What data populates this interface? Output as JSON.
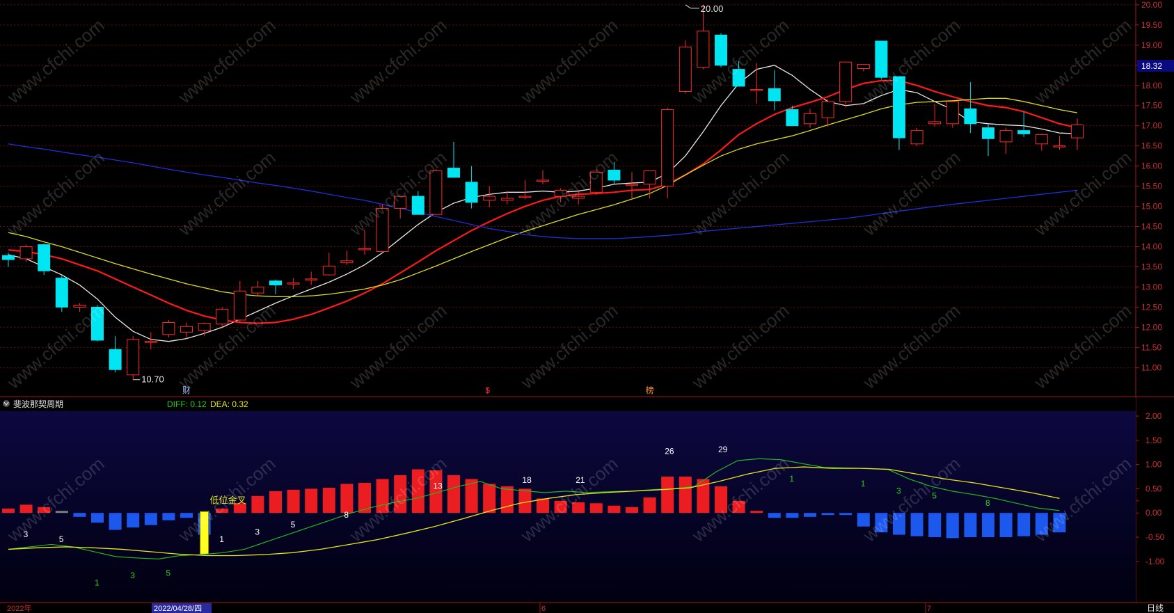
{
  "colors": {
    "up": "#ff2a2a",
    "down": "#00e5f2",
    "ma5": "#e8e8e8",
    "ma10": "#ff1a1a",
    "ma20": "#dcdc20",
    "ma60": "#2030d8",
    "diff": "#22b822",
    "dea": "#e6e620",
    "hist_up": "#ff2020",
    "hist_down": "#2060ff",
    "hist_neutral": "#888888",
    "grid": "#6a0a0a",
    "axis_text": "#cc3030",
    "sub_bg_top": "#0d0840",
    "sub_bg_bottom": "#000010"
  },
  "chart_data": [
    {
      "type": "candlestick",
      "y_axis_ticks": [
        "20.00",
        "19.50",
        "19.00",
        "18.50",
        "18.00",
        "17.50",
        "17.00",
        "16.50",
        "16.00",
        "15.50",
        "15.00",
        "14.50",
        "14.00",
        "13.50",
        "13.00",
        "12.50",
        "12.00",
        "11.50",
        "11.00"
      ],
      "ylim": [
        10.35,
        20.05
      ],
      "current_price_label": "18.32",
      "current_price_value": 18.32,
      "high_annotation": "20.00",
      "high_value": 20.0,
      "high_index": 38,
      "low_annotation": "10.70",
      "low_value": 10.7,
      "low_index": 7,
      "event_markers": [
        {
          "index": 10,
          "label": "财",
          "color": "#a0c0ff"
        },
        {
          "index": 27,
          "label": "$",
          "color": "#ff3030"
        },
        {
          "index": 36,
          "label": "榜",
          "color": "#ff9030"
        }
      ],
      "candles": [
        {
          "o": 13.78,
          "h": 13.85,
          "l": 13.5,
          "c": 13.68
        },
        {
          "o": 13.7,
          "h": 14.05,
          "l": 13.62,
          "c": 14.0
        },
        {
          "o": 14.05,
          "h": 14.08,
          "l": 13.3,
          "c": 13.4
        },
        {
          "o": 13.22,
          "h": 13.28,
          "l": 12.38,
          "c": 12.5
        },
        {
          "o": 12.5,
          "h": 12.6,
          "l": 12.38,
          "c": 12.55
        },
        {
          "o": 12.5,
          "h": 12.55,
          "l": 11.65,
          "c": 11.68
        },
        {
          "o": 11.45,
          "h": 11.78,
          "l": 10.88,
          "c": 10.95
        },
        {
          "o": 10.82,
          "h": 11.78,
          "l": 10.7,
          "c": 11.7
        },
        {
          "o": 11.65,
          "h": 11.88,
          "l": 11.45,
          "c": 11.65
        },
        {
          "o": 11.82,
          "h": 12.18,
          "l": 11.75,
          "c": 12.12
        },
        {
          "o": 11.88,
          "h": 12.12,
          "l": 11.72,
          "c": 12.02
        },
        {
          "o": 11.92,
          "h": 12.12,
          "l": 11.78,
          "c": 12.1
        },
        {
          "o": 12.08,
          "h": 12.5,
          "l": 12.0,
          "c": 12.45
        },
        {
          "o": 12.18,
          "h": 13.15,
          "l": 12.1,
          "c": 12.9
        },
        {
          "o": 12.85,
          "h": 13.15,
          "l": 12.78,
          "c": 13.0
        },
        {
          "o": 13.15,
          "h": 13.18,
          "l": 12.82,
          "c": 13.05
        },
        {
          "o": 13.08,
          "h": 13.22,
          "l": 12.95,
          "c": 13.1
        },
        {
          "o": 13.18,
          "h": 13.38,
          "l": 13.05,
          "c": 13.2
        },
        {
          "o": 13.3,
          "h": 13.85,
          "l": 13.28,
          "c": 13.52
        },
        {
          "o": 13.6,
          "h": 13.9,
          "l": 13.55,
          "c": 13.65
        },
        {
          "o": 13.95,
          "h": 14.42,
          "l": 13.8,
          "c": 13.95
        },
        {
          "o": 13.88,
          "h": 15.05,
          "l": 13.85,
          "c": 14.95
        },
        {
          "o": 14.95,
          "h": 15.2,
          "l": 14.7,
          "c": 15.25
        },
        {
          "o": 15.25,
          "h": 15.38,
          "l": 14.82,
          "c": 14.8
        },
        {
          "o": 14.8,
          "h": 15.92,
          "l": 14.8,
          "c": 15.88
        },
        {
          "o": 15.95,
          "h": 16.6,
          "l": 15.72,
          "c": 15.72
        },
        {
          "o": 15.6,
          "h": 16.0,
          "l": 14.95,
          "c": 15.1
        },
        {
          "o": 15.15,
          "h": 15.5,
          "l": 14.98,
          "c": 15.25
        },
        {
          "o": 15.15,
          "h": 15.38,
          "l": 15.05,
          "c": 15.2
        },
        {
          "o": 15.25,
          "h": 15.65,
          "l": 15.18,
          "c": 15.25
        },
        {
          "o": 15.65,
          "h": 15.9,
          "l": 15.55,
          "c": 15.65
        },
        {
          "o": 15.25,
          "h": 15.45,
          "l": 15.1,
          "c": 15.4
        },
        {
          "o": 15.2,
          "h": 15.4,
          "l": 15.05,
          "c": 15.25
        },
        {
          "o": 15.35,
          "h": 15.92,
          "l": 15.28,
          "c": 15.85
        },
        {
          "o": 15.9,
          "h": 16.1,
          "l": 15.55,
          "c": 15.65
        },
        {
          "o": 15.55,
          "h": 15.85,
          "l": 15.18,
          "c": 15.55
        },
        {
          "o": 15.55,
          "h": 15.88,
          "l": 15.2,
          "c": 15.88
        },
        {
          "o": 15.5,
          "h": 17.45,
          "l": 15.2,
          "c": 17.4
        },
        {
          "o": 17.85,
          "h": 19.12,
          "l": 17.8,
          "c": 18.95
        },
        {
          "o": 18.45,
          "h": 20.0,
          "l": 18.4,
          "c": 19.35
        },
        {
          "o": 19.25,
          "h": 19.3,
          "l": 18.45,
          "c": 18.5
        },
        {
          "o": 18.4,
          "h": 18.6,
          "l": 17.98,
          "c": 17.98
        },
        {
          "o": 17.88,
          "h": 18.55,
          "l": 17.55,
          "c": 17.9
        },
        {
          "o": 17.92,
          "h": 18.38,
          "l": 17.38,
          "c": 17.62
        },
        {
          "o": 17.4,
          "h": 17.5,
          "l": 17.1,
          "c": 17.0
        },
        {
          "o": 17.05,
          "h": 17.42,
          "l": 16.95,
          "c": 17.3
        },
        {
          "o": 17.2,
          "h": 17.65,
          "l": 16.98,
          "c": 17.6
        },
        {
          "o": 17.6,
          "h": 18.55,
          "l": 17.45,
          "c": 18.58
        },
        {
          "o": 18.42,
          "h": 18.5,
          "l": 18.35,
          "c": 18.52
        },
        {
          "o": 19.1,
          "h": 19.1,
          "l": 18.15,
          "c": 18.2
        },
        {
          "o": 18.22,
          "h": 18.22,
          "l": 16.4,
          "c": 16.7
        },
        {
          "o": 16.55,
          "h": 16.95,
          "l": 16.5,
          "c": 16.88
        },
        {
          "o": 17.05,
          "h": 17.55,
          "l": 16.98,
          "c": 17.1
        },
        {
          "o": 17.05,
          "h": 17.6,
          "l": 16.95,
          "c": 17.6
        },
        {
          "o": 17.42,
          "h": 18.08,
          "l": 16.82,
          "c": 17.05
        },
        {
          "o": 16.95,
          "h": 17.05,
          "l": 16.25,
          "c": 16.68
        },
        {
          "o": 16.6,
          "h": 16.95,
          "l": 16.3,
          "c": 16.88
        },
        {
          "o": 16.88,
          "h": 17.35,
          "l": 16.72,
          "c": 16.8
        },
        {
          "o": 16.55,
          "h": 16.8,
          "l": 16.38,
          "c": 16.78
        },
        {
          "o": 16.5,
          "h": 16.75,
          "l": 16.4,
          "c": 16.5
        },
        {
          "o": 16.7,
          "h": 17.18,
          "l": 16.4,
          "c": 17.02
        }
      ],
      "ma_series": [
        {
          "key": "ma5",
          "values": [
            13.8,
            13.7,
            13.5,
            13.3,
            13.05,
            12.7,
            12.25,
            11.9,
            11.7,
            11.65,
            11.72,
            11.85,
            12.0,
            12.2,
            12.4,
            12.6,
            12.78,
            12.95,
            13.12,
            13.32,
            13.55,
            13.85,
            14.2,
            14.55,
            14.85,
            15.08,
            15.22,
            15.3,
            15.35,
            15.35,
            15.38,
            15.35,
            15.38,
            15.45,
            15.55,
            15.58,
            15.6,
            15.82,
            16.25,
            16.85,
            17.5,
            18.05,
            18.4,
            18.5,
            18.25,
            17.9,
            17.6,
            17.5,
            17.55,
            17.75,
            17.9,
            17.82,
            17.6,
            17.4,
            17.1,
            17.05,
            17.02,
            17.0,
            16.92,
            16.82,
            16.8
          ]
        },
        {
          "key": "ma10",
          "values": [
            13.92,
            13.88,
            13.8,
            13.7,
            13.55,
            13.4,
            13.2,
            13.0,
            12.8,
            12.6,
            12.42,
            12.28,
            12.18,
            12.12,
            12.1,
            12.12,
            12.2,
            12.32,
            12.48,
            12.65,
            12.85,
            13.08,
            13.35,
            13.62,
            13.9,
            14.15,
            14.4,
            14.62,
            14.82,
            15.0,
            15.15,
            15.25,
            15.3,
            15.32,
            15.35,
            15.4,
            15.42,
            15.55,
            15.78,
            16.05,
            16.4,
            16.78,
            17.05,
            17.28,
            17.45,
            17.58,
            17.72,
            17.9,
            18.05,
            18.12,
            18.12,
            18.0,
            17.85,
            17.72,
            17.6,
            17.5,
            17.45,
            17.35,
            17.2,
            17.05,
            16.95
          ]
        },
        {
          "key": "ma20",
          "values": [
            14.35,
            14.25,
            14.12,
            14.0,
            13.86,
            13.72,
            13.58,
            13.45,
            13.32,
            13.2,
            13.08,
            12.98,
            12.88,
            12.82,
            12.78,
            12.76,
            12.76,
            12.78,
            12.82,
            12.88,
            12.95,
            13.05,
            13.18,
            13.35,
            13.52,
            13.7,
            13.88,
            14.05,
            14.22,
            14.38,
            14.52,
            14.66,
            14.8,
            14.92,
            15.04,
            15.18,
            15.32,
            15.52,
            15.78,
            16.02,
            16.25,
            16.42,
            16.55,
            16.65,
            16.75,
            16.88,
            17.02,
            17.15,
            17.28,
            17.42,
            17.52,
            17.58,
            17.6,
            17.62,
            17.65,
            17.68,
            17.68,
            17.6,
            17.5,
            17.4,
            17.32
          ]
        },
        {
          "key": "ma60",
          "values": [
            16.55,
            16.48,
            16.42,
            16.35,
            16.28,
            16.22,
            16.15,
            16.08,
            16.0,
            15.92,
            15.85,
            15.78,
            15.72,
            15.65,
            15.58,
            15.52,
            15.45,
            15.38,
            15.3,
            15.22,
            15.15,
            15.05,
            14.95,
            14.85,
            14.75,
            14.65,
            14.55,
            14.45,
            14.38,
            14.3,
            14.25,
            14.22,
            14.2,
            14.2,
            14.2,
            14.22,
            14.25,
            14.28,
            14.32,
            14.38,
            14.42,
            14.46,
            14.5,
            14.54,
            14.58,
            14.62,
            14.66,
            14.7,
            14.76,
            14.82,
            14.88,
            14.94,
            15.0,
            15.05,
            15.1,
            15.15,
            15.2,
            15.25,
            15.3,
            15.35,
            15.4
          ]
        }
      ]
    },
    {
      "type": "bar",
      "panel_title": "斐波那契周期",
      "diff_label": "DIFF: 0.12",
      "dea_label": "DEA: 0.32",
      "y_axis_ticks": [
        "2.00",
        "1.50",
        "1.00",
        "0.50",
        "0.00",
        "-0.50",
        "-1.00"
      ],
      "ylim": [
        -1.85,
        2.1
      ],
      "histogram": [
        0.09,
        0.17,
        0.12,
        0.0,
        -0.08,
        -0.2,
        -0.35,
        -0.3,
        -0.25,
        -0.15,
        -0.1,
        -0.45,
        0.09,
        0.2,
        0.35,
        0.45,
        0.48,
        0.5,
        0.52,
        0.6,
        0.62,
        0.7,
        0.78,
        0.9,
        0.88,
        0.78,
        0.7,
        0.6,
        0.55,
        0.5,
        0.3,
        0.25,
        0.22,
        0.2,
        0.15,
        0.12,
        0.32,
        0.75,
        0.75,
        0.7,
        0.55,
        0.25,
        0.02,
        -0.1,
        -0.1,
        -0.08,
        -0.03,
        -0.02,
        -0.28,
        -0.4,
        -0.45,
        -0.48,
        -0.5,
        -0.52,
        -0.5,
        -0.5,
        -0.5,
        -0.48,
        -0.45,
        -0.4
      ],
      "diff": [
        -0.75,
        -0.7,
        -0.65,
        -0.7,
        -0.8,
        -0.9,
        -0.93,
        -0.95,
        -0.88,
        -0.86,
        -0.82,
        -0.75,
        -0.6,
        -0.45,
        -0.3,
        -0.15,
        0.0,
        0.12,
        0.22,
        0.3,
        0.42,
        0.55,
        0.65,
        0.5,
        0.46,
        0.42,
        0.45,
        0.42,
        0.44,
        0.45,
        0.48,
        0.5,
        0.55,
        0.85,
        1.08,
        1.12,
        1.1,
        1.02,
        0.94,
        0.93,
        0.92,
        0.9,
        0.7,
        0.55,
        0.45,
        0.38,
        0.3,
        0.2,
        0.1,
        0.05
      ],
      "dea": [
        -0.75,
        -0.72,
        -0.7,
        -0.72,
        -0.75,
        -0.8,
        -0.85,
        -0.88,
        -0.88,
        -0.86,
        -0.82,
        -0.75,
        -0.65,
        -0.55,
        -0.42,
        -0.28,
        -0.12,
        0.05,
        0.2,
        0.3,
        0.38,
        0.42,
        0.45,
        0.48,
        0.52,
        0.65,
        0.8,
        0.92,
        0.95,
        0.92,
        0.92,
        0.9,
        0.8,
        0.7,
        0.62,
        0.52,
        0.42,
        0.3
      ],
      "cycle_labels": [
        {
          "text": "3",
          "index": 1,
          "value": -0.5,
          "color": "#ffffff"
        },
        {
          "text": "5",
          "index": 3,
          "value": -0.6,
          "color": "#ffffff"
        },
        {
          "text": "1",
          "index": 5,
          "value": -1.5,
          "color": "#22d822"
        },
        {
          "text": "3",
          "index": 7,
          "value": -1.35,
          "color": "#22d822"
        },
        {
          "text": "5",
          "index": 9,
          "value": -1.3,
          "color": "#22d822"
        },
        {
          "text": "1",
          "index": 12,
          "value": -0.6,
          "color": "#ffffff"
        },
        {
          "text": "3",
          "index": 14,
          "value": -0.45,
          "color": "#ffffff"
        },
        {
          "text": "5",
          "index": 16,
          "value": -0.3,
          "color": "#ffffff"
        },
        {
          "text": "8",
          "index": 19,
          "value": -0.1,
          "color": "#ffffff"
        },
        {
          "text": "13",
          "index": 24,
          "value": 0.5,
          "color": "#ffffff"
        },
        {
          "text": "18",
          "index": 29,
          "value": 0.62,
          "color": "#ffffff"
        },
        {
          "text": "21",
          "index": 32,
          "value": 0.62,
          "color": "#ffffff"
        },
        {
          "text": "26",
          "index": 37,
          "value": 1.22,
          "color": "#ffffff"
        },
        {
          "text": "29",
          "index": 40,
          "value": 1.25,
          "color": "#ffffff"
        },
        {
          "text": "1",
          "index": 44,
          "value": 0.65,
          "color": "#22d822"
        },
        {
          "text": "1",
          "index": 48,
          "value": 0.55,
          "color": "#22d822"
        },
        {
          "text": "3",
          "index": 50,
          "value": 0.4,
          "color": "#22d822"
        },
        {
          "text": "5",
          "index": 52,
          "value": 0.3,
          "color": "#22d822"
        },
        {
          "text": "8",
          "index": 55,
          "value": 0.15,
          "color": "#22d822"
        }
      ],
      "signal": {
        "label": "低位金叉",
        "index": 11
      }
    }
  ],
  "bottom_bar": {
    "year_label": "2022年",
    "date_cursor": "2022/04/28/四",
    "month_6": "6",
    "month_7": "7",
    "period_label": "日线"
  }
}
